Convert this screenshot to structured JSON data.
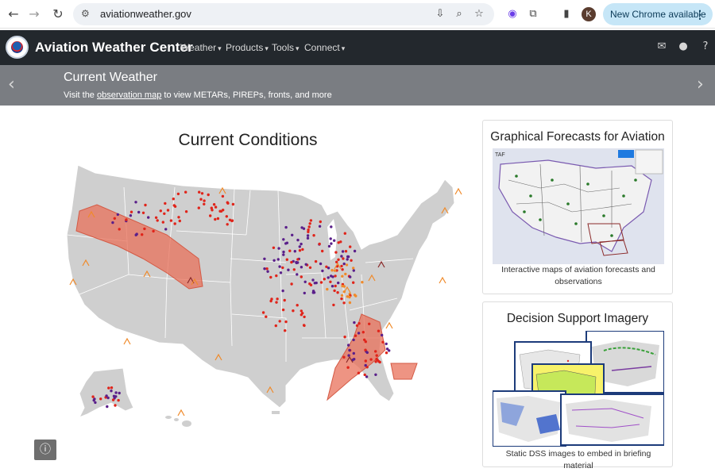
{
  "browser": {
    "url": "aviationweather.gov",
    "avatar_letter": "K",
    "update_label": "New Chrome available"
  },
  "header": {
    "title": "Aviation Weather Center",
    "menus": [
      "Weather",
      "Products",
      "Tools",
      "Connect"
    ]
  },
  "banner": {
    "title": "Current Weather",
    "sub_prefix": "Visit the ",
    "sub_link": "observation map",
    "sub_suffix": " to view METARs, PIREPs, fronts, and more"
  },
  "main": {
    "title": "Current Conditions"
  },
  "cards": [
    {
      "title": "Graphical Forecasts for Aviation",
      "desc": "Interactive maps of aviation forecasts and observations"
    },
    {
      "title": "Decision Support Imagery",
      "desc": "Static DSS images to embed in briefing material"
    }
  ],
  "colors": {
    "header_bg": "#23282d",
    "banner_bg": "#7a7d82",
    "land": "#cfcfcf",
    "sigmet": "#e8705a",
    "pirep_red": "#e0241a",
    "pirep_purple": "#5a1f8a",
    "pirep_orange": "#f08a2a"
  },
  "icons": {
    "back": "arrow-left-icon",
    "forward": "arrow-right-icon",
    "reload": "reload-icon",
    "mail": "envelope-icon",
    "user": "user-icon",
    "help": "question-icon",
    "info": "info-icon"
  }
}
